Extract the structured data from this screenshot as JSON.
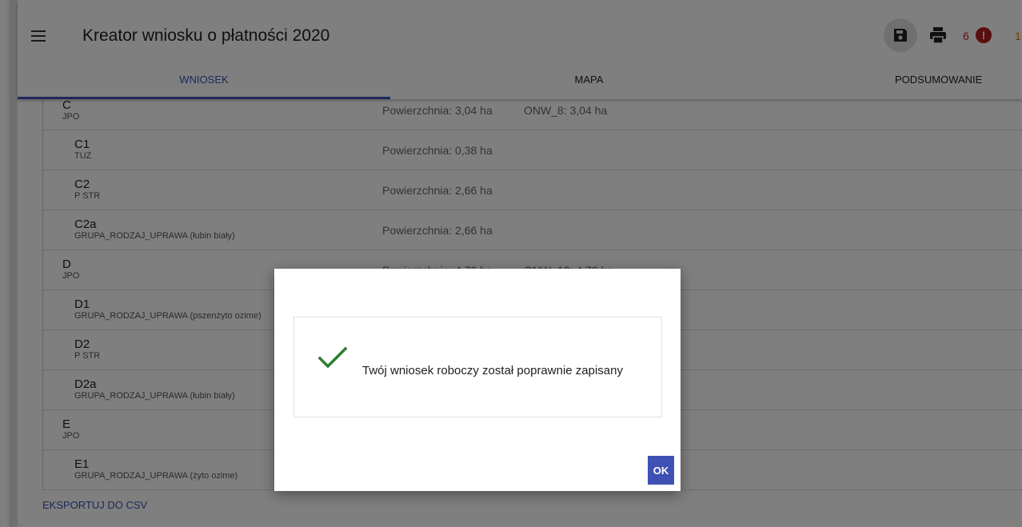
{
  "header": {
    "title": "Kreator wniosku o płatności 2020",
    "warning_count": "6",
    "error_count": "1"
  },
  "tabs": [
    {
      "label": "WNIOSEK",
      "active": true
    },
    {
      "label": "MAPA",
      "active": false
    },
    {
      "label": "PODSUMOWANIE",
      "active": false
    }
  ],
  "rows": [
    {
      "code": "C",
      "sub": "JPO",
      "area": "Powierzchnia: 3,04 ha",
      "onw": "ONW_8: 3,04 ha",
      "link": "I"
    },
    {
      "code": "C1",
      "sub": "TUZ",
      "area": "Powierzchnia: 0,38 ha",
      "onw": "",
      "link": "I"
    },
    {
      "code": "C2",
      "sub": "P STR",
      "area": "Powierzchnia: 2,66 ha",
      "onw": "",
      "link": "I"
    },
    {
      "code": "C2a",
      "sub": "GRUPA_RODZAJ_UPRAWA (łubin biały)",
      "area": "Powierzchnia: 2,66 ha",
      "onw": "",
      "link": "I"
    },
    {
      "code": "D",
      "sub": "JPO",
      "area": "Powierzchnia: 4,70 ha",
      "onw": "ONW_10: 4,70 ha",
      "link": "I"
    },
    {
      "code": "D1",
      "sub": "GRUPA_RODZAJ_UPRAWA (pszenżyto ozime)",
      "area": "",
      "onw": "",
      "link": "I"
    },
    {
      "code": "D2",
      "sub": "P STR",
      "area": "",
      "onw": "",
      "link": "I"
    },
    {
      "code": "D2a",
      "sub": "GRUPA_RODZAJ_UPRAWA (łubin biały)",
      "area": "",
      "onw": "",
      "link": "I"
    },
    {
      "code": "E",
      "sub": "JPO",
      "area": "",
      "onw": "",
      "link": "I"
    },
    {
      "code": "E1",
      "sub": "GRUPA_RODZAJ_UPRAWA (żyto ozime)",
      "area": "",
      "onw": "",
      "link": "I"
    }
  ],
  "export_label": "EKSPORTUJ DO CSV",
  "dialog": {
    "message": "Twój wniosek roboczy został poprawnie zapisany",
    "ok_label": "OK"
  },
  "colors": {
    "primary": "#3f51b5",
    "success_check": "#2e7d32",
    "error": "#b71c1c"
  }
}
